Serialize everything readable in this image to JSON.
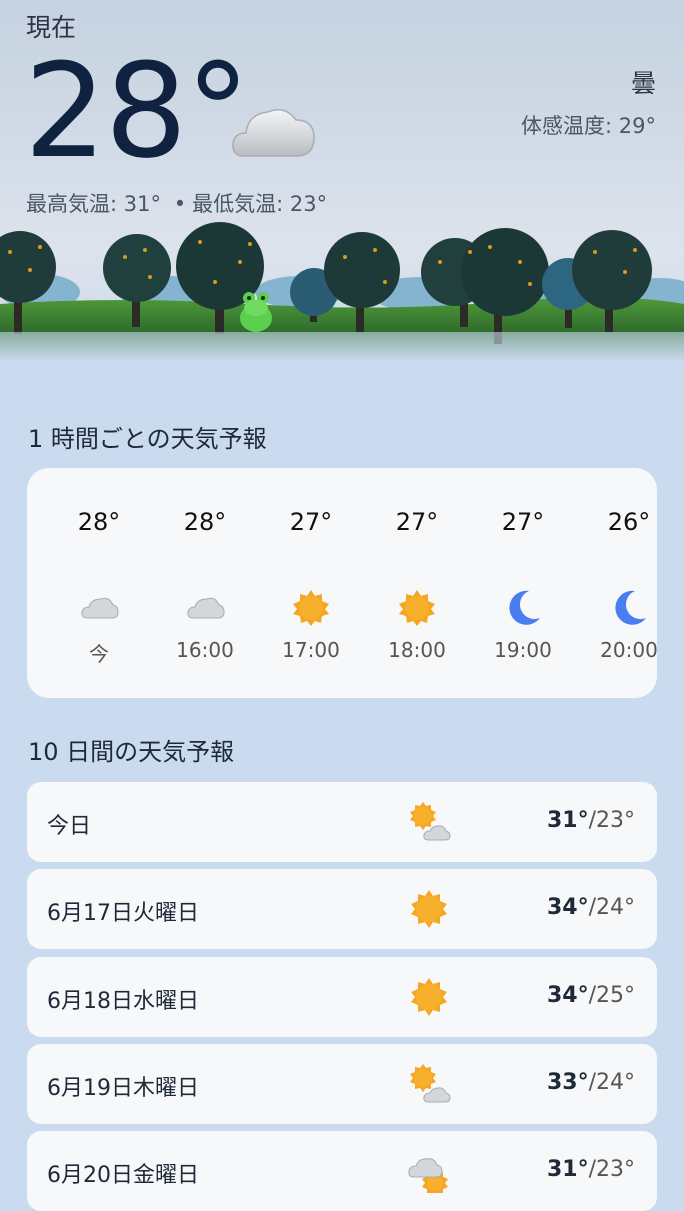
{
  "current": {
    "label": "現在",
    "temp": "28°",
    "condition": "曇",
    "feels_label": "体感温度:",
    "feels_value": "29°",
    "high_label": "最高気温:",
    "high": "31°",
    "separator": "•",
    "low_label": "最低気温:",
    "low": "23°",
    "icon": "cloud-icon"
  },
  "hourly": {
    "title": "1 時間ごとの天気予報",
    "items": [
      {
        "temp": "28°",
        "time": "今",
        "icon": "cloud-icon"
      },
      {
        "temp": "28°",
        "time": "16:00",
        "icon": "cloud-icon"
      },
      {
        "temp": "27°",
        "time": "17:00",
        "icon": "sun-icon"
      },
      {
        "temp": "27°",
        "time": "18:00",
        "icon": "sun-icon"
      },
      {
        "temp": "27°",
        "time": "19:00",
        "icon": "moon-icon"
      },
      {
        "temp": "26°",
        "time": "20:00",
        "icon": "moon-icon"
      }
    ]
  },
  "daily": {
    "title": "10 日間の天気予報",
    "items": [
      {
        "day": "今日",
        "high": "31°",
        "slash": "/",
        "low": "23°",
        "icon": "sun-cloud-icon"
      },
      {
        "day": "6月17日火曜日",
        "high": "34°",
        "slash": "/",
        "low": "24°",
        "icon": "sun-icon"
      },
      {
        "day": "6月18日水曜日",
        "high": "34°",
        "slash": "/",
        "low": "25°",
        "icon": "sun-icon"
      },
      {
        "day": "6月19日木曜日",
        "high": "33°",
        "slash": "/",
        "low": "24°",
        "icon": "sun-cloud-icon"
      },
      {
        "day": "6月20日金曜日",
        "high": "31°",
        "slash": "/",
        "low": "23°",
        "icon": "cloud-sun-icon"
      }
    ]
  },
  "colors": {
    "page_bg": "#cadbef",
    "card_bg": "#f7f8fa",
    "sun": "#f6a623",
    "moon": "#4a7ef0",
    "cloud": "#c9ccd1"
  }
}
